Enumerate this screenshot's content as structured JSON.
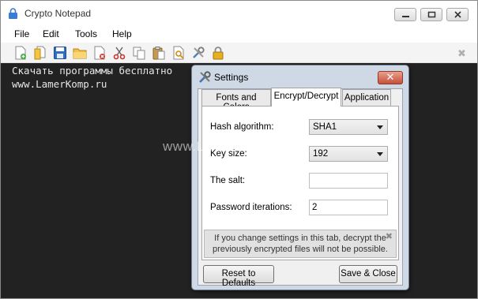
{
  "window": {
    "title": "Crypto Notepad"
  },
  "menu": {
    "items": [
      "File",
      "Edit",
      "Tools",
      "Help"
    ]
  },
  "toolbar": {
    "icons": [
      "new-file-icon",
      "open-file-icon",
      "save-icon",
      "open-folder-icon",
      "delete-file-icon",
      "cut-icon",
      "copy-icon",
      "paste-icon",
      "find-icon",
      "settings-icon",
      "lock-icon"
    ],
    "close_glyph": "✖"
  },
  "editor": {
    "lines": [
      "Скачать программы бесплатно",
      "www.LamerKomp.ru"
    ]
  },
  "settings": {
    "title": "Settings",
    "close_glyph": "✕",
    "tabs": [
      "Fonts and Colors",
      "Encrypt/Decrypt",
      "Application"
    ],
    "active_tab": "Encrypt/Decrypt",
    "hash_label": "Hash algorithm:",
    "hash_value": "SHA1",
    "key_label": "Key size:",
    "key_value": "192",
    "salt_label": "The salt:",
    "salt_value": "",
    "iter_label": "Password iterations:",
    "iter_value": "2",
    "note_line1": "If you change settings in this tab, decrypt the",
    "note_line2": "previously encrypted files will not be possible.",
    "note_close": "✖",
    "reset_label": "Reset to Defaults",
    "save_label": "Save & Close"
  },
  "watermark": "www.LamerKomp.ru",
  "colors": {
    "editor_bg": "#222222",
    "editor_text": "#e6e6e6",
    "dialog_frame": "#cfd9e6",
    "close_red": "#c7503a"
  }
}
